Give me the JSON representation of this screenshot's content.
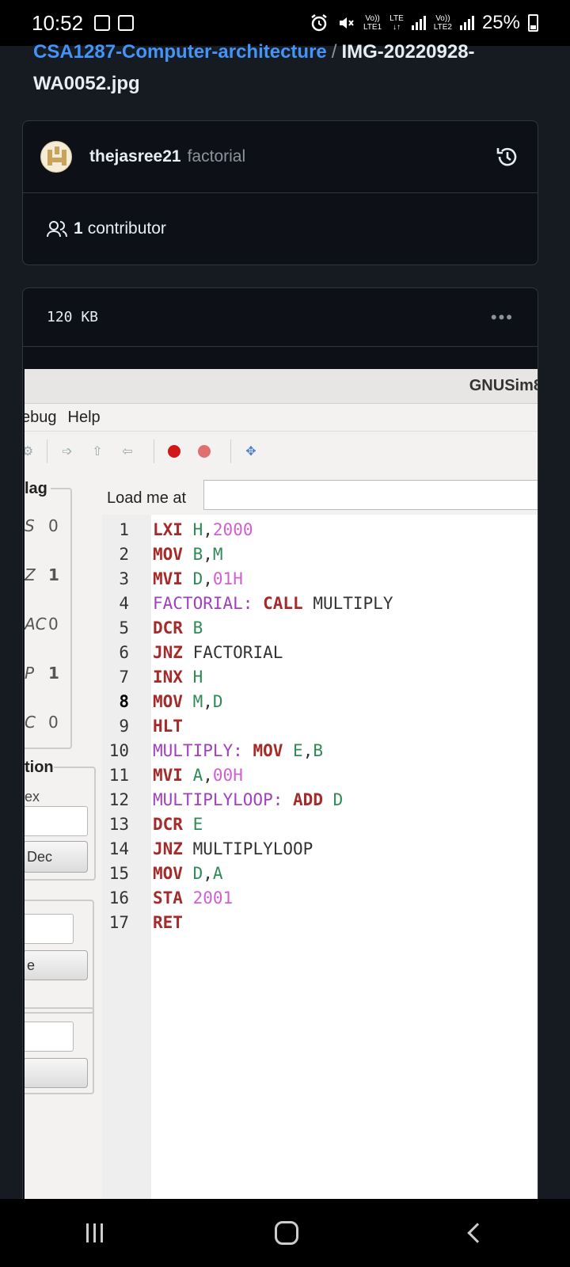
{
  "status_bar": {
    "time": "10:52",
    "net1_top": "Vo))",
    "net1_bottom": "LTE1",
    "net2_top": "LTE",
    "net2_bottom": "↓↑",
    "net3_top": "Vo))",
    "net3_bottom": "LTE2",
    "battery": "25%"
  },
  "breadcrumb": {
    "repo": "CSA1287-Computer-architecture",
    "separator": "/",
    "file": "IMG-20220928-WA0052.jpg"
  },
  "commit": {
    "author": "thejasree21",
    "message": "factorial",
    "contributors_count": "1",
    "contributors_label": "contributor"
  },
  "file": {
    "size": "120 KB",
    "menu": "•••"
  },
  "gnusim": {
    "title": "GNUSim8",
    "menu": [
      "ebug",
      "Help"
    ],
    "flag_title": "lag",
    "flags": [
      {
        "name": "S",
        "value": "0"
      },
      {
        "name": "Z",
        "value": "1"
      },
      {
        "name": "AC",
        "value": "0"
      },
      {
        "name": "P",
        "value": "1"
      },
      {
        "name": "C",
        "value": "0"
      }
    ],
    "conversion_title": "tion",
    "conversion_sub": "ex",
    "dec_button": "Dec",
    "box2_button": "e",
    "load_label": "Load me at",
    "current_line": 8,
    "code": [
      [
        [
          "op",
          "LXI"
        ],
        [
          "plain",
          " "
        ],
        [
          "reg",
          "H"
        ],
        [
          "plain",
          ","
        ],
        [
          "num",
          "2000"
        ]
      ],
      [
        [
          "op",
          "MOV"
        ],
        [
          "plain",
          " "
        ],
        [
          "reg",
          "B"
        ],
        [
          "plain",
          ","
        ],
        [
          "reg",
          "M"
        ]
      ],
      [
        [
          "op",
          "MVI"
        ],
        [
          "plain",
          " "
        ],
        [
          "reg",
          "D"
        ],
        [
          "plain",
          ","
        ],
        [
          "num",
          "01H"
        ]
      ],
      [
        [
          "lbl",
          "FACTORIAL:"
        ],
        [
          "plain",
          " "
        ],
        [
          "op",
          "CALL"
        ],
        [
          "plain",
          " MULTIPLY"
        ]
      ],
      [
        [
          "op",
          "DCR"
        ],
        [
          "plain",
          " "
        ],
        [
          "reg",
          "B"
        ]
      ],
      [
        [
          "op",
          "JNZ"
        ],
        [
          "plain",
          " FACTORIAL"
        ]
      ],
      [
        [
          "op",
          "INX"
        ],
        [
          "plain",
          " "
        ],
        [
          "reg",
          "H"
        ]
      ],
      [
        [
          "op",
          "MOV"
        ],
        [
          "plain",
          " "
        ],
        [
          "reg",
          "M"
        ],
        [
          "plain",
          ","
        ],
        [
          "reg",
          "D"
        ]
      ],
      [
        [
          "op",
          "HLT"
        ]
      ],
      [
        [
          "lbl",
          "MULTIPLY:"
        ],
        [
          "plain",
          " "
        ],
        [
          "op",
          "MOV"
        ],
        [
          "plain",
          " "
        ],
        [
          "reg",
          "E"
        ],
        [
          "plain",
          ","
        ],
        [
          "reg",
          "B"
        ]
      ],
      [
        [
          "op",
          "MVI"
        ],
        [
          "plain",
          " "
        ],
        [
          "reg",
          "A"
        ],
        [
          "plain",
          ","
        ],
        [
          "num",
          "00H"
        ]
      ],
      [
        [
          "lbl",
          "MULTIPLYLOOP:"
        ],
        [
          "plain",
          " "
        ],
        [
          "op",
          "ADD"
        ],
        [
          "plain",
          " "
        ],
        [
          "reg",
          "D"
        ]
      ],
      [
        [
          "op",
          "DCR"
        ],
        [
          "plain",
          " "
        ],
        [
          "reg",
          "E"
        ]
      ],
      [
        [
          "op",
          "JNZ"
        ],
        [
          "plain",
          " MULTIPLYLOOP"
        ]
      ],
      [
        [
          "op",
          "MOV"
        ],
        [
          "plain",
          " "
        ],
        [
          "reg",
          "D"
        ],
        [
          "plain",
          ","
        ],
        [
          "reg",
          "A"
        ]
      ],
      [
        [
          "op",
          "STA"
        ],
        [
          "plain",
          " "
        ],
        [
          "num",
          "2001"
        ]
      ],
      [
        [
          "op",
          "RET"
        ]
      ]
    ]
  }
}
